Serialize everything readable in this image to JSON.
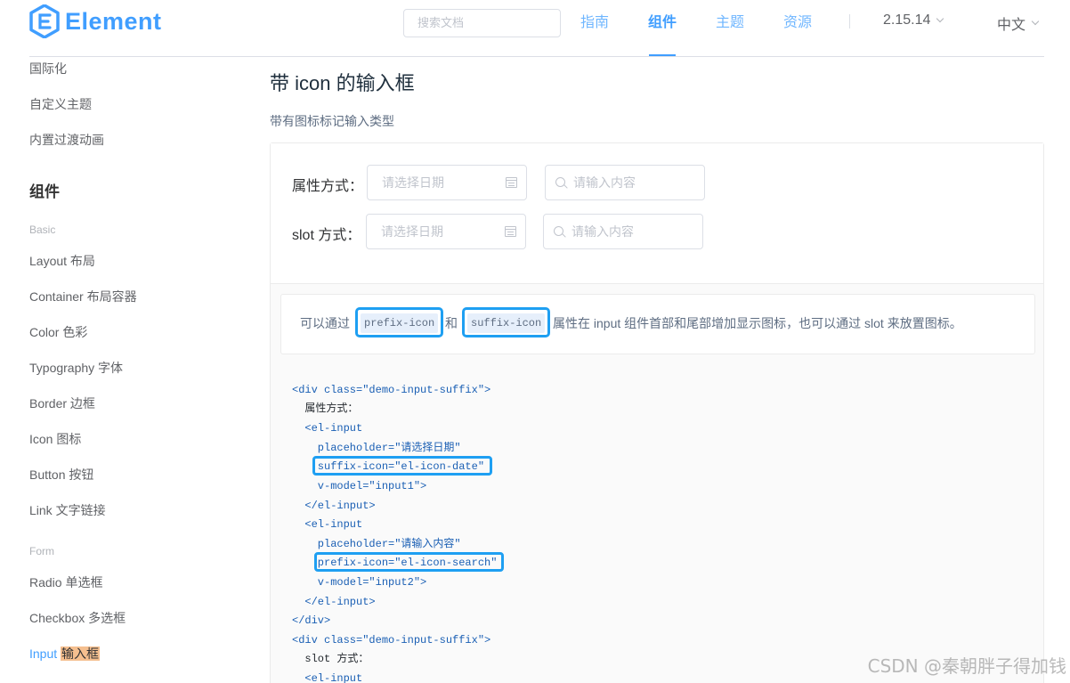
{
  "header": {
    "logo_text": "Element",
    "search_placeholder": "搜索文档",
    "nav": [
      {
        "label": "指南"
      },
      {
        "label": "组件"
      },
      {
        "label": "主题"
      },
      {
        "label": "资源"
      }
    ],
    "version": "2.15.14",
    "language": "中文"
  },
  "sidebar": {
    "items_top": [
      "国际化",
      "自定义主题",
      "内置过渡动画"
    ],
    "group_title": "组件",
    "basic_label": "Basic",
    "basic_items": [
      "Layout 布局",
      "Container 布局容器",
      "Color 色彩",
      "Typography 字体",
      "Border 边框",
      "Icon 图标",
      "Button 按钮",
      "Link 文字链接"
    ],
    "form_label": "Form",
    "form_items": [
      "Radio 单选框",
      "Checkbox 多选框"
    ],
    "active_prefix": "Input ",
    "active_highlight": "输入框"
  },
  "main": {
    "title": "带 icon 的输入框",
    "description": "带有图标标记输入类型",
    "demo": {
      "row1_label": "属性方式：",
      "row2_label": "slot 方式：",
      "date_placeholder": "请选择日期",
      "search_placeholder": "请输入内容"
    },
    "tip": {
      "before": "可以通过",
      "code1": "prefix-icon",
      "mid": "和",
      "code2": "suffix-icon",
      "after": "属性在 input 组件首部和尾部增加显示图标，也可以通过 slot 来放置图标。"
    },
    "code_lines": [
      "<div class=\"demo-input-suffix\">",
      "  属性方式：",
      "  <el-input",
      "    placeholder=\"请选择日期\"",
      "    suffix-icon=\"el-icon-date\"",
      "    v-model=\"input1\">",
      "  </el-input>",
      "  <el-input",
      "    placeholder=\"请输入内容\"",
      "    prefix-icon=\"el-icon-search\"",
      "    v-model=\"input2\">",
      "  </el-input>",
      "</div>",
      "<div class=\"demo-input-suffix\">",
      "  slot 方式：",
      "  <el-input"
    ]
  },
  "watermark": "CSDN @秦朝胖子得加钱"
}
